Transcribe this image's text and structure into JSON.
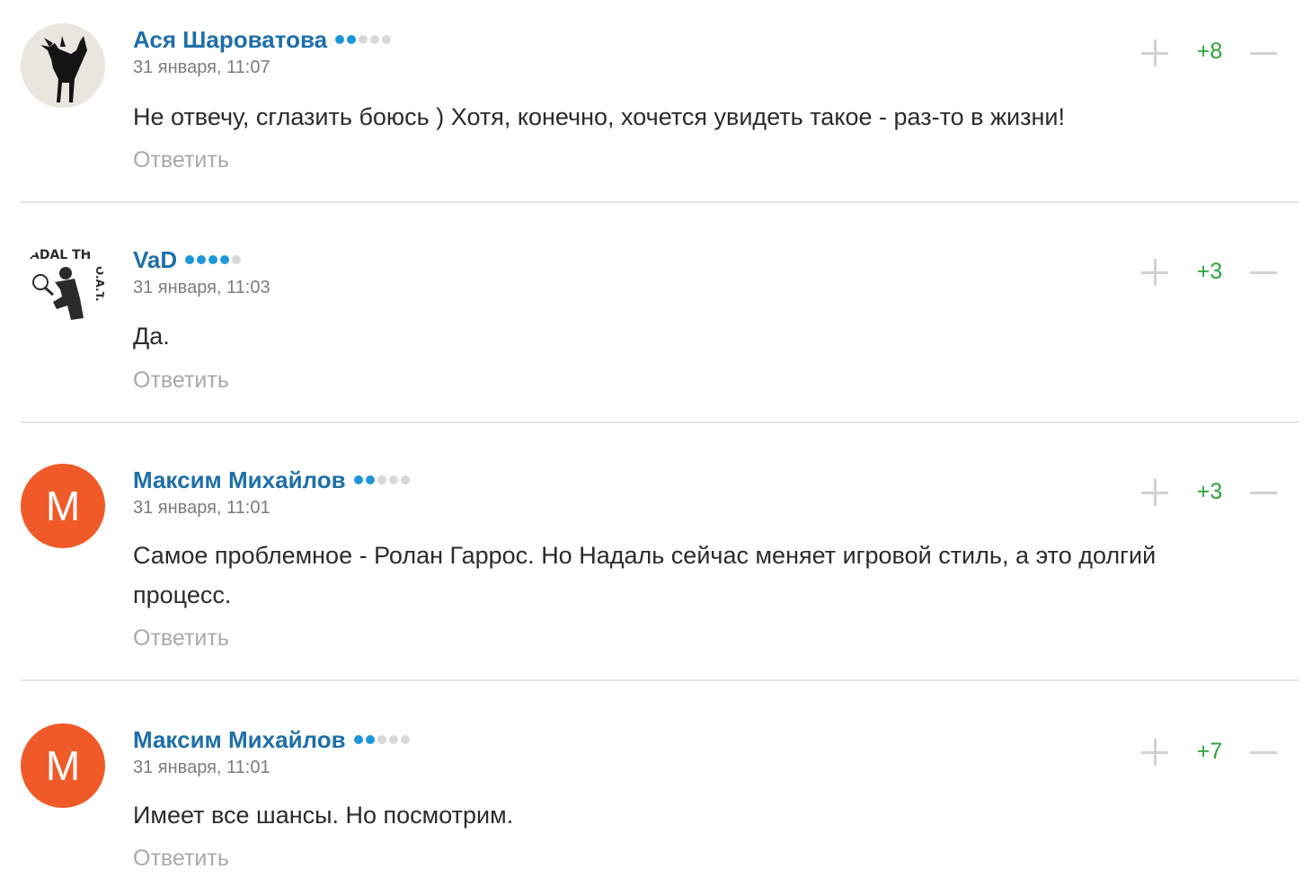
{
  "colors": {
    "author": "#1f6fa8",
    "rating_on": "#1d97d8",
    "rating_off": "#d8d8d8",
    "score_positive": "#2aa33a",
    "avatar_bg": "#f05a28",
    "muted": "#a9a9a9"
  },
  "reply_label": "Ответить",
  "comments": [
    {
      "author": "Ася Шароватова",
      "rating_level": 2,
      "rating_max": 5,
      "date": "31 января, 11:07",
      "text": "Не отвечу, сглазить боюсь ) Хотя, конечно, хочется увидеть такое - раз-то в жизни!",
      "score": "+8",
      "avatar": {
        "type": "image",
        "icon": "black-cat-photo"
      }
    },
    {
      "author": "VaD",
      "rating_level": 4,
      "rating_max": 5,
      "date": "31 января, 11:03",
      "text": "Да.",
      "score": "+3",
      "avatar": {
        "type": "image",
        "icon": "tennis-player-logo",
        "text_top": "ADAL TH",
        "text_side": "O.A.T."
      }
    },
    {
      "author": "Максим Михайлов",
      "rating_level": 2,
      "rating_max": 5,
      "date": "31 января, 11:01",
      "text": "Самое проблемное - Ролан Гаррос. Но Надаль сейчас меняет игровой стиль, а это долгий процесс.",
      "score": "+3",
      "avatar": {
        "type": "letter",
        "letter": "М"
      }
    },
    {
      "author": "Максим Михайлов",
      "rating_level": 2,
      "rating_max": 5,
      "date": "31 января, 11:01",
      "text": "Имеет все шансы. Но посмотрим.",
      "score": "+7",
      "avatar": {
        "type": "letter",
        "letter": "М"
      }
    }
  ]
}
